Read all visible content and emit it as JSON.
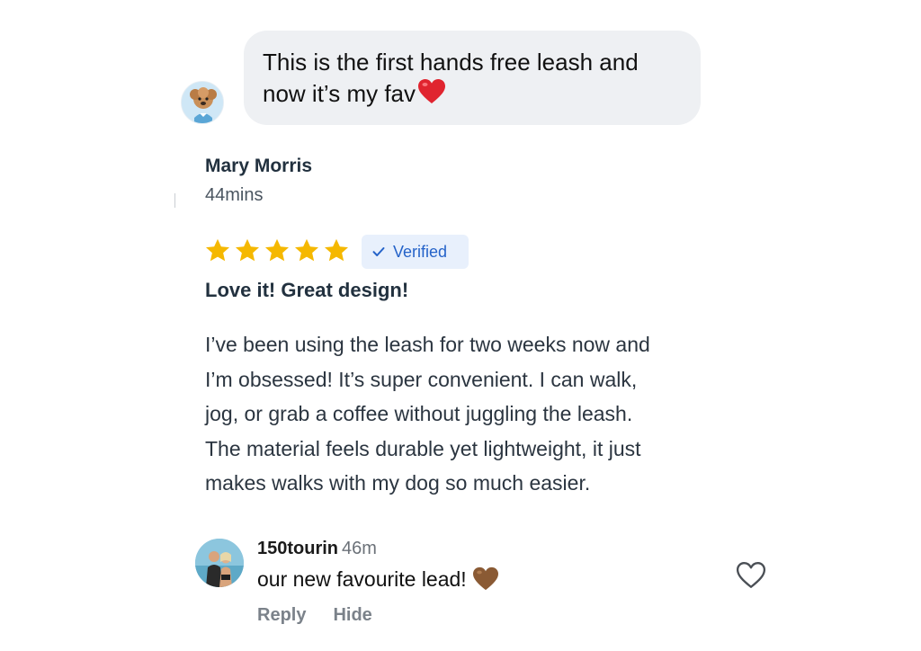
{
  "chat": {
    "message": "This is the first hands free leash and\nnow it’s my fav",
    "emoji_icon": "red-heart-icon"
  },
  "review": {
    "author": "Mary Morris",
    "time": "44mins",
    "rating": 5,
    "rating_max": 5,
    "star_color": "#f5b800",
    "verified_label": "Verified",
    "verified_color": "#2563c9",
    "title": "Love it! Great design!",
    "body_lines": [
      "I’ve been using the leash for two weeks now and",
      "I’m obsessed! It’s super convenient. I can walk,",
      "jog, or grab a coffee without juggling the leash.",
      "The material feels durable yet lightweight, it just",
      "makes walks with my dog so much easier."
    ]
  },
  "comment": {
    "username": "150tourin",
    "time": "46m",
    "text": "our new favourite lead!",
    "emoji_icon": "brown-heart-icon",
    "like_icon": "heart-outline-icon",
    "reply_label": "Reply",
    "hide_label": "Hide"
  }
}
